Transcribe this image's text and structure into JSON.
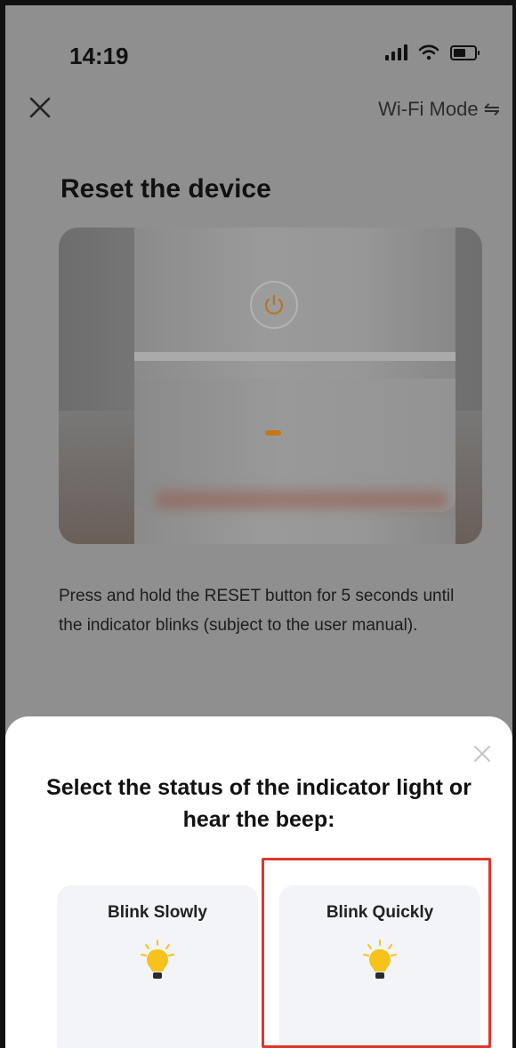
{
  "status_bar": {
    "time": "14:19",
    "icons": [
      "signal-icon",
      "wifi-icon",
      "battery-icon"
    ]
  },
  "nav": {
    "close_icon": "close-icon",
    "mode_label": "Wi-Fi Mode",
    "mode_icon": "⇋"
  },
  "page": {
    "title": "Reset the device",
    "instructions": "Press and hold the RESET button for 5 seconds until the indicator blinks (subject to the user manual)."
  },
  "sheet": {
    "title": "Select the status of the indicator light or hear the beep:",
    "options": [
      {
        "label": "Blink Slowly",
        "icon": "light-bulb-icon"
      },
      {
        "label": "Blink Quickly",
        "icon": "light-bulb-icon"
      }
    ],
    "highlighted_option": "Blink Quickly"
  },
  "colors": {
    "bulb_yellow": "#f6c21c",
    "highlight_red": "#e0362d",
    "indicator_led": "#c9751a"
  }
}
